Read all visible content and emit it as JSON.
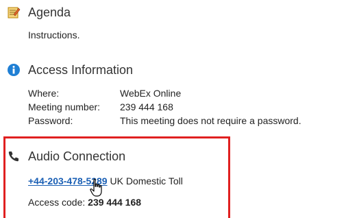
{
  "agenda": {
    "title": "Agenda",
    "text": "Instructions."
  },
  "access": {
    "title": "Access Information",
    "rows": [
      {
        "label": "Where:",
        "value": "WebEx Online"
      },
      {
        "label": "Meeting number:",
        "value": "239 444 168"
      },
      {
        "label": "Password:",
        "value": "This meeting does not require a password."
      }
    ]
  },
  "audio": {
    "title": "Audio Connection",
    "phone": "+44-203-478-5289",
    "phone_desc": "UK Domestic Toll",
    "access_code_label": "Access code:",
    "access_code": "239 444 168"
  },
  "colors": {
    "highlight": "#e02020",
    "link": "#1a5fb4",
    "info_icon": "#1f7fd4"
  }
}
